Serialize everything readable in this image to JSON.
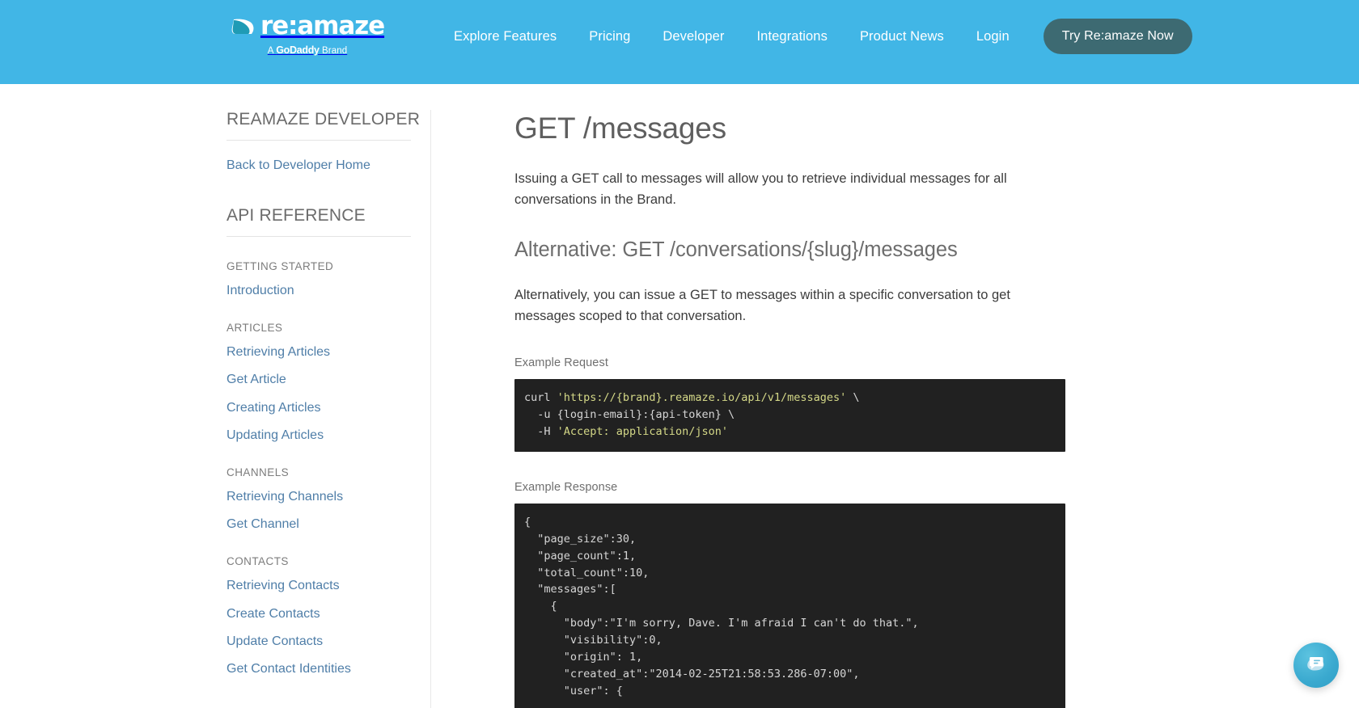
{
  "header": {
    "brand": {
      "wordmark": "re:amaze",
      "subline_prefix": "A",
      "subline_brandword": "GoDaddy",
      "subline_suffix": "Brand"
    },
    "nav": [
      {
        "label": "Explore Features"
      },
      {
        "label": "Pricing"
      },
      {
        "label": "Developer"
      },
      {
        "label": "Integrations"
      },
      {
        "label": "Product News"
      },
      {
        "label": "Login"
      }
    ],
    "cta_label": "Try Re:amaze Now",
    "bg_color": "#41b6e6",
    "cta_color": "#3d6a72"
  },
  "sidebar": {
    "title": "REAMAZE DEVELOPER",
    "back_link": "Back to Developer Home",
    "api_reference_title": "API REFERENCE",
    "groups": [
      {
        "label": "GETTING STARTED",
        "links": [
          "Introduction"
        ]
      },
      {
        "label": "ARTICLES",
        "links": [
          "Retrieving Articles",
          "Get Article",
          "Creating Articles",
          "Updating Articles"
        ]
      },
      {
        "label": "CHANNELS",
        "links": [
          "Retrieving Channels",
          "Get Channel"
        ]
      },
      {
        "label": "CONTACTS",
        "links": [
          "Retrieving Contacts",
          "Create Contacts",
          "Update Contacts",
          "Get Contact Identities"
        ]
      }
    ],
    "link_color": "#4f7ea8"
  },
  "content": {
    "title": "GET /messages",
    "intro_paragraph": "Issuing a GET call to messages will allow you to retrieve individual messages for all conversations in the Brand.",
    "alt_heading": "Alternative: GET /conversations/{slug}/messages",
    "alt_paragraph": "Alternatively, you can issue a GET to messages within a specific conversation to get messages scoped to that conversation.",
    "request_label": "Example Request",
    "request_code_pre": "curl ",
    "request_code_url": "'https://{brand}.reamaze.io/api/v1/messages'",
    "request_code_mid": " \\\n  -u {login-email}:{api-token} \\\n  -H ",
    "request_code_accept": "'Accept: application/json'",
    "response_label": "Example Response",
    "response_code": "{\n  \"page_size\":30,\n  \"page_count\":1,\n  \"total_count\":10,\n  \"messages\":[\n    {\n      \"body\":\"I'm sorry, Dave. I'm afraid I can't do that.\",\n      \"visibility\":0,\n      \"origin\": 1,\n      \"created_at\":\"2014-02-25T21:58:53.286-07:00\",\n      \"user\": {",
    "code_bg": "#212121",
    "code_text_color": "#d6d6d6",
    "code_string_color": "#d4d887"
  },
  "chat_widget": {
    "icon": "chat-bubble-icon",
    "color": "#3aa9cf"
  }
}
